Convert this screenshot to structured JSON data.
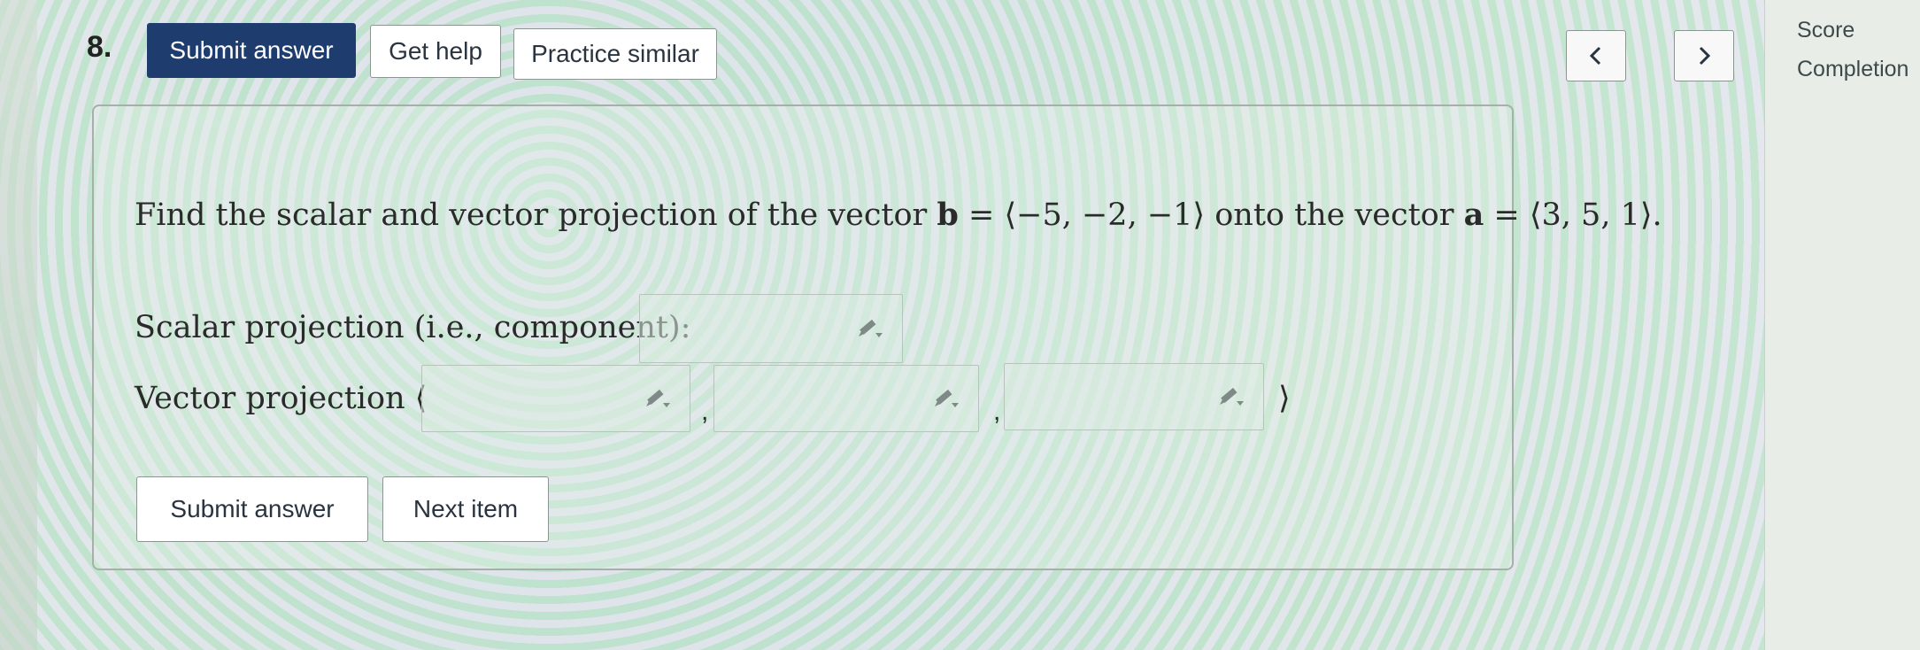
{
  "question_number": "8.",
  "toolbar": {
    "submit_label": "Submit answer",
    "help_label": "Get help",
    "practice_label": "Practice similar"
  },
  "nav": {
    "prev_glyph": "<",
    "next_glyph": ">"
  },
  "sidebar": {
    "score_label": "Score",
    "completion_label": "Completion"
  },
  "question": {
    "text_1": "Find the scalar and vector projection of the vector ",
    "vec_b": "b",
    "text_2": " = ⟨−5, −2, −1⟩ onto the vector ",
    "vec_a": "a",
    "text_3": " = ⟨3, 5, 1⟩."
  },
  "answers": {
    "scalar_label": "Scalar projection (i.e., component):",
    "vector_label": "Vector projection ⟨",
    "vector_close": "⟩",
    "separator": ",",
    "scalar_value": "",
    "vector_values": [
      "",
      "",
      ""
    ]
  },
  "footer": {
    "submit_label": "Submit answer",
    "next_label": "Next item"
  },
  "icons": {
    "pencil": "pencil-icon",
    "prev": "chevron-left-icon",
    "next": "chevron-right-icon"
  },
  "colors": {
    "primary_button": "#1e3c6e",
    "card_border": "#a6b0a8"
  }
}
